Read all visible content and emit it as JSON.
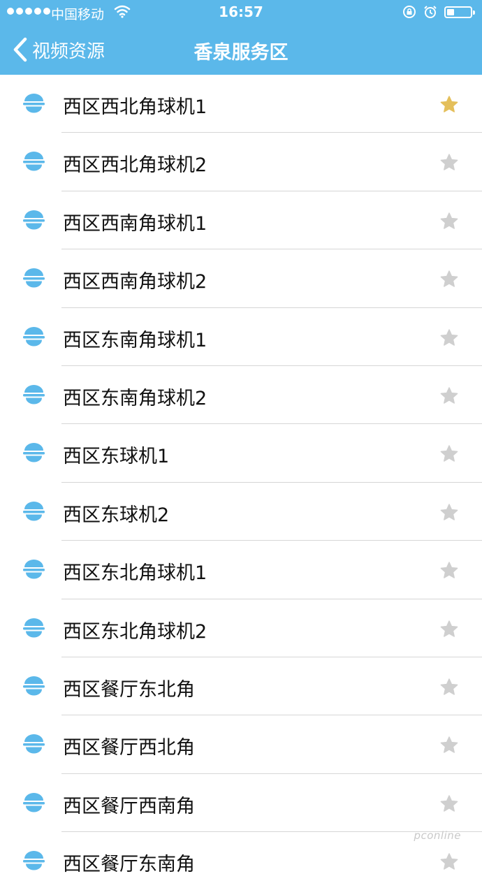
{
  "status_bar": {
    "carrier": "中国移动",
    "time": "16:57",
    "battery_level": 0.3
  },
  "nav": {
    "back_label": "视频资源",
    "title": "香泉服务区"
  },
  "colors": {
    "accent": "#5bb8ea",
    "star_active": "#e4bf5b",
    "star_inactive": "#cfcfcf"
  },
  "cameras": [
    {
      "label": "西区西北角球机1",
      "favorite": true
    },
    {
      "label": "西区西北角球机2",
      "favorite": false
    },
    {
      "label": "西区西南角球机1",
      "favorite": false
    },
    {
      "label": "西区西南角球机2",
      "favorite": false
    },
    {
      "label": "西区东南角球机1",
      "favorite": false
    },
    {
      "label": "西区东南角球机2",
      "favorite": false
    },
    {
      "label": "西区东球机1",
      "favorite": false
    },
    {
      "label": "西区东球机2",
      "favorite": false
    },
    {
      "label": "西区东北角球机1",
      "favorite": false
    },
    {
      "label": "西区东北角球机2",
      "favorite": false
    },
    {
      "label": "西区餐厅东北角",
      "favorite": false
    },
    {
      "label": "西区餐厅西北角",
      "favorite": false
    },
    {
      "label": "西区餐厅西南角",
      "favorite": false
    },
    {
      "label": "西区餐厅东南角",
      "favorite": false
    }
  ],
  "icons": {
    "camera": "dome-camera-icon",
    "favorite": "star-icon",
    "back": "chevron-left-icon"
  },
  "watermark": "pconline"
}
